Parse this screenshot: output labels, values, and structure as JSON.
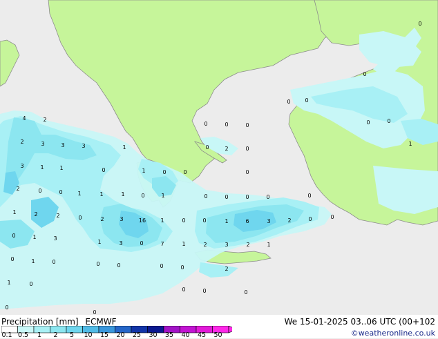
{
  "title": "Precipitation [mm]",
  "model": "ECMWF",
  "datetime": "We 15-01-2025 03..06 UTC (00+102",
  "credit": "©weatheronline.co.uk",
  "legend": {
    "labels": [
      "0.1",
      "0.5",
      "1",
      "2",
      "5",
      "10",
      "15",
      "20",
      "25",
      "30",
      "35",
      "40",
      "45",
      "50"
    ],
    "colors": [
      "#fefefe",
      "#c8f7f7",
      "#a8f0f5",
      "#8ce6f0",
      "#6fd6ee",
      "#50bbe6",
      "#3a97dc",
      "#2566c8",
      "#1235a8",
      "#0b1990",
      "#a214c6",
      "#c214d2",
      "#e21ad8",
      "#ff28e8"
    ]
  },
  "map": {
    "land_color": "#c6f59a",
    "sea_color": "#ececec",
    "border_color": "#8c8c8c"
  },
  "values": [
    {
      "text": "4"
    },
    {
      "text": "2"
    },
    {
      "text": "2"
    },
    {
      "text": "3"
    },
    {
      "text": "3"
    },
    {
      "text": "3"
    },
    {
      "text": "3"
    },
    {
      "text": "1"
    },
    {
      "text": "2"
    },
    {
      "text": "1"
    },
    {
      "text": "1"
    },
    {
      "text": "0"
    },
    {
      "text": "2"
    },
    {
      "text": "2"
    },
    {
      "text": "0"
    },
    {
      "text": "0"
    },
    {
      "text": "1"
    },
    {
      "text": "1"
    },
    {
      "text": "1"
    },
    {
      "text": "0"
    },
    {
      "text": "1"
    },
    {
      "text": "3"
    },
    {
      "text": "2"
    },
    {
      "text": "0"
    },
    {
      "text": "3"
    },
    {
      "text": "16"
    },
    {
      "text": "1"
    },
    {
      "text": "0"
    },
    {
      "text": "0"
    },
    {
      "text": "1"
    },
    {
      "text": "1"
    },
    {
      "text": "1"
    },
    {
      "text": "3"
    },
    {
      "text": "0"
    },
    {
      "text": "7"
    },
    {
      "text": "1"
    },
    {
      "text": "0"
    },
    {
      "text": "1"
    },
    {
      "text": "0"
    },
    {
      "text": "0"
    },
    {
      "text": "0"
    },
    {
      "text": "0"
    },
    {
      "text": "1"
    },
    {
      "text": "0"
    },
    {
      "text": "0"
    },
    {
      "text": "0"
    },
    {
      "text": "0"
    },
    {
      "text": "1"
    },
    {
      "text": "0"
    },
    {
      "text": "0"
    },
    {
      "text": "0"
    },
    {
      "text": "0"
    },
    {
      "text": "0"
    },
    {
      "text": "0"
    },
    {
      "text": "0"
    },
    {
      "text": "0"
    },
    {
      "text": "0"
    },
    {
      "text": "2"
    },
    {
      "text": "0"
    },
    {
      "text": "0"
    },
    {
      "text": "0"
    },
    {
      "text": "0"
    },
    {
      "text": "0"
    },
    {
      "text": "1"
    },
    {
      "text": "6"
    },
    {
      "text": "3"
    },
    {
      "text": "2"
    },
    {
      "text": "0"
    },
    {
      "text": "2"
    },
    {
      "text": "3"
    },
    {
      "text": "2"
    },
    {
      "text": "1"
    },
    {
      "text": "2"
    },
    {
      "text": "0"
    },
    {
      "text": "0"
    },
    {
      "text": "0"
    },
    {
      "text": "0"
    },
    {
      "text": "1"
    },
    {
      "text": "0"
    },
    {
      "text": "0"
    },
    {
      "text": "0"
    },
    {
      "text": "0"
    },
    {
      "text": "0"
    },
    {
      "text": "0"
    }
  ]
}
